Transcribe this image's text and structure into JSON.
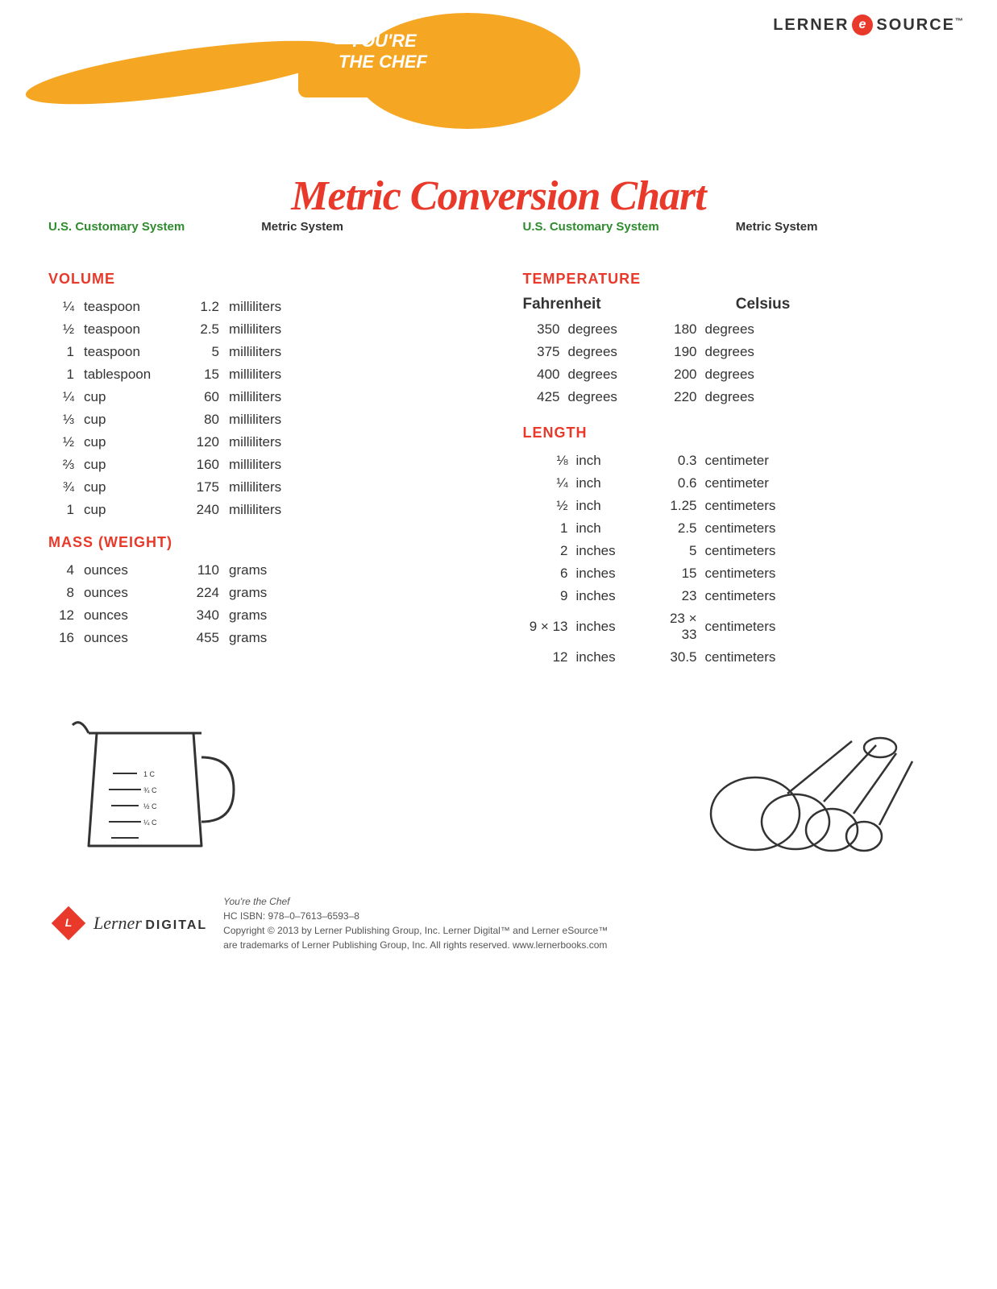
{
  "header": {
    "lerner_text": "LERNER",
    "e_text": "e",
    "source_text": "SOURCE",
    "tm": "™"
  },
  "spoon": {
    "text_line1": "YOU'RE",
    "text_line2": "THE CHEF"
  },
  "title": "Metric Conversion Chart",
  "column_headers": {
    "us_customary": "U.S. Customary System",
    "metric": "Metric System"
  },
  "volume": {
    "label": "VOLUME",
    "rows": [
      {
        "qty": "¼",
        "unit": "teaspoon",
        "metric_num": "1.2",
        "metric_unit": "milliliters"
      },
      {
        "qty": "½",
        "unit": "teaspoon",
        "metric_num": "2.5",
        "metric_unit": "milliliters"
      },
      {
        "qty": "1",
        "unit": "teaspoon",
        "metric_num": "5",
        "metric_unit": "milliliters"
      },
      {
        "qty": "1",
        "unit": "tablespoon",
        "metric_num": "15",
        "metric_unit": "milliliters"
      },
      {
        "qty": "¼",
        "unit": "cup",
        "metric_num": "60",
        "metric_unit": "milliliters"
      },
      {
        "qty": "⅓",
        "unit": "cup",
        "metric_num": "80",
        "metric_unit": "milliliters"
      },
      {
        "qty": "½",
        "unit": "cup",
        "metric_num": "120",
        "metric_unit": "milliliters"
      },
      {
        "qty": "⅔",
        "unit": "cup",
        "metric_num": "160",
        "metric_unit": "milliliters"
      },
      {
        "qty": "¾",
        "unit": "cup",
        "metric_num": "175",
        "metric_unit": "milliliters"
      },
      {
        "qty": "1",
        "unit": "cup",
        "metric_num": "240",
        "metric_unit": "milliliters"
      }
    ]
  },
  "mass": {
    "label": "MASS (WEIGHT)",
    "rows": [
      {
        "qty": "4",
        "unit": "ounces",
        "metric_num": "110",
        "metric_unit": "grams"
      },
      {
        "qty": "8",
        "unit": "ounces",
        "metric_num": "224",
        "metric_unit": "grams"
      },
      {
        "qty": "12",
        "unit": "ounces",
        "metric_num": "340",
        "metric_unit": "grams"
      },
      {
        "qty": "16",
        "unit": "ounces",
        "metric_num": "455",
        "metric_unit": "grams"
      }
    ]
  },
  "temperature": {
    "label": "TEMPERATURE",
    "fahrenheit_label": "Fahrenheit",
    "celsius_label": "Celsius",
    "rows": [
      {
        "f_num": "350",
        "f_unit": "degrees",
        "c_num": "180",
        "c_unit": "degrees"
      },
      {
        "f_num": "375",
        "f_unit": "degrees",
        "c_num": "190",
        "c_unit": "degrees"
      },
      {
        "f_num": "400",
        "f_unit": "degrees",
        "c_num": "200",
        "c_unit": "degrees"
      },
      {
        "f_num": "425",
        "f_unit": "degrees",
        "c_num": "220",
        "c_unit": "degrees"
      }
    ]
  },
  "length": {
    "label": "LENGTH",
    "rows": [
      {
        "qty": "⅛",
        "unit": "inch",
        "metric_num": "0.3",
        "metric_unit": "centimeter"
      },
      {
        "qty": "¼",
        "unit": "inch",
        "metric_num": "0.6",
        "metric_unit": "centimeter"
      },
      {
        "qty": "½",
        "unit": "inch",
        "metric_num": "1.25",
        "metric_unit": "centimeters"
      },
      {
        "qty": "1",
        "unit": "inch",
        "metric_num": "2.5",
        "metric_unit": "centimeters"
      },
      {
        "qty": "2",
        "unit": "inches",
        "metric_num": "5",
        "metric_unit": "centimeters"
      },
      {
        "qty": "6",
        "unit": "inches",
        "metric_num": "15",
        "metric_unit": "centimeters"
      },
      {
        "qty": "9",
        "unit": "inches",
        "metric_num": "23",
        "metric_unit": "centimeters"
      },
      {
        "qty": "9 × 13",
        "unit": "inches",
        "metric_num": "23 × 33",
        "metric_unit": "centimeters"
      },
      {
        "qty": "12",
        "unit": "inches",
        "metric_num": "30.5",
        "metric_unit": "centimeters"
      }
    ]
  },
  "footer": {
    "book_title": "You're the Chef",
    "isbn": "HC ISBN: 978–0–7613–6593–8",
    "copyright": "Copyright © 2013 by Lerner Publishing Group, Inc. Lerner Digital™ and Lerner eSource™",
    "trademark": "are trademarks of Lerner Publishing Group, Inc. All rights reserved. www.lernerbooks.com",
    "lerner": "Lerner",
    "digital": "DIGITAL"
  }
}
